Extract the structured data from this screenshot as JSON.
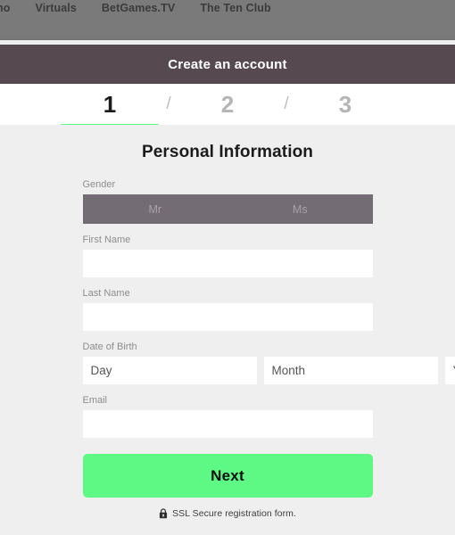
{
  "topnav": {
    "items": [
      {
        "label": "no"
      },
      {
        "label": "Virtuals"
      },
      {
        "label": "BetGames.TV"
      },
      {
        "label": "The Ten Club"
      }
    ]
  },
  "titlebar": {
    "title": "Create an account"
  },
  "stepper": {
    "steps": [
      {
        "label": "1",
        "active": true
      },
      {
        "label": "2",
        "active": false
      },
      {
        "label": "3",
        "active": false
      }
    ],
    "separator": "/"
  },
  "form": {
    "title": "Personal Information",
    "gender": {
      "label": "Gender",
      "options": [
        {
          "label": "Mr"
        },
        {
          "label": "Ms"
        }
      ]
    },
    "first_name": {
      "label": "First Name",
      "value": "",
      "placeholder": ""
    },
    "last_name": {
      "label": "Last Name",
      "value": "",
      "placeholder": ""
    },
    "date_of_birth": {
      "label": "Date of Birth",
      "day": {
        "value": "",
        "placeholder": "Day"
      },
      "month": {
        "value": "",
        "placeholder": "Month"
      },
      "year": {
        "value": "",
        "placeholder": "Year"
      }
    },
    "email": {
      "label": "Email",
      "value": "",
      "placeholder": ""
    },
    "submit_label": "Next",
    "ssl_notice": "SSL Secure registration form.",
    "ssl_icon": "lock-icon"
  },
  "colors": {
    "accent_green": "#5ef884",
    "titlebar": "#564a50",
    "topnav": "#7a7a7a",
    "gender_bar": "#746c74",
    "page_background": "#efefef"
  }
}
